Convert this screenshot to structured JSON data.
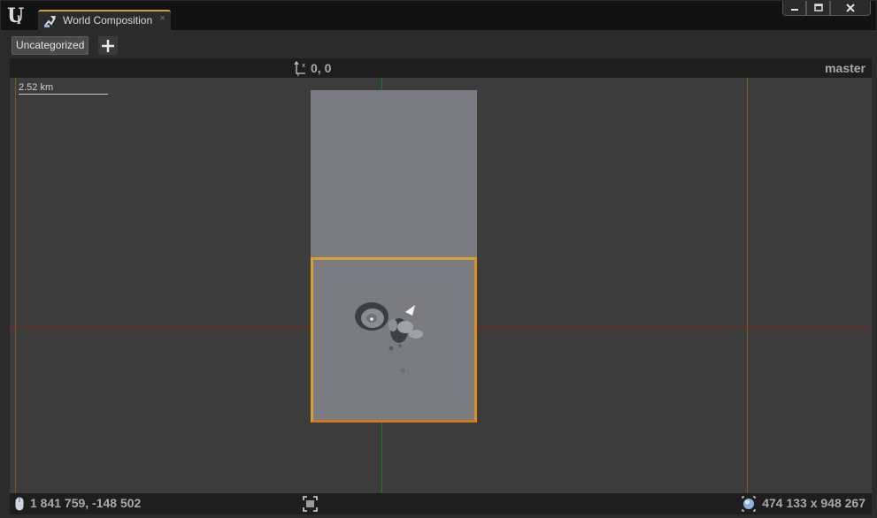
{
  "window": {
    "tab_title": "World Composition",
    "controls": {
      "minimize": "minimize",
      "maximize": "maximize",
      "close": "close"
    }
  },
  "toolbar": {
    "layer_chip": "Uncategorized",
    "add_label": "add-layer"
  },
  "viewport": {
    "origin_coords": "0, 0",
    "level_name": "master",
    "scale_label": "2.52 km",
    "mouse_coords": "1 841 759, -148 502",
    "world_size": "474 133 x 948 267"
  },
  "icons": {
    "logo": "unreal-logo-icon",
    "tab": "world-composition-icon",
    "origin": "axis-origin-icon",
    "mouse": "mouse-icon",
    "fit": "fit-selection-icon",
    "globe": "globe-icon",
    "add": "plus-icon"
  },
  "colors": {
    "tab_accent": "#c9a52a",
    "selection_border": "#d8a030",
    "axis_x": "#8a2020",
    "axis_y": "#1f7a1f",
    "world_bounds": "#7a5a1f",
    "tile_fill": "#7b7c82"
  }
}
